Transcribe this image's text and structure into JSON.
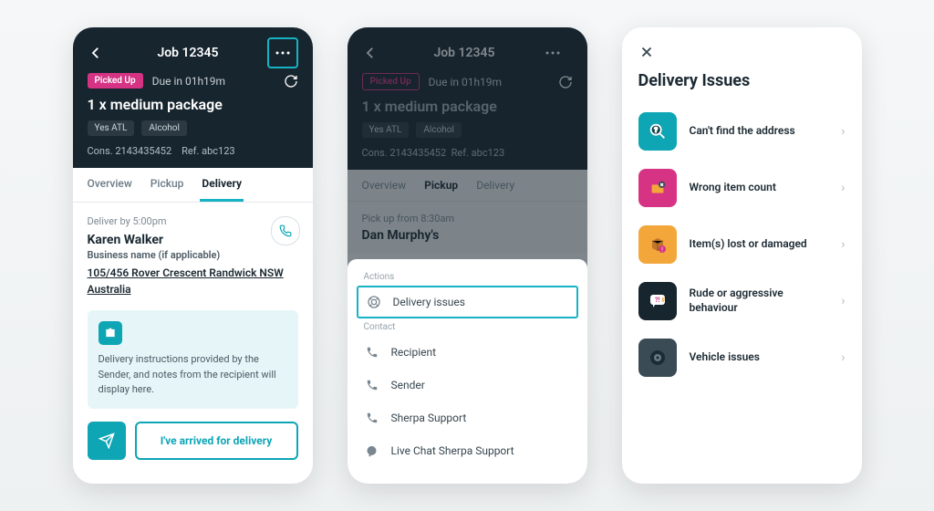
{
  "phone1": {
    "header": {
      "title": "Job 12345",
      "more_icon": "more-menu",
      "back_icon": "back"
    },
    "status": {
      "badge": "Picked Up",
      "due": "Due in 01h19m"
    },
    "package_line": "1 x medium package",
    "tags": [
      "Yes ATL",
      "Alcohol"
    ],
    "refs": {
      "cons": "Cons. 2143435452",
      "ref": "Ref. abc123"
    },
    "tabs": [
      "Overview",
      "Pickup",
      "Delivery"
    ],
    "active_tab": "Delivery",
    "deliver_by": "Deliver by 5:00pm",
    "recipient_name": "Karen Walker",
    "business": "Business name (if applicable)",
    "address": "105/456 Rover Crescent Randwick NSW Australia",
    "note": "Delivery instructions provided by the Sender, and notes from the recipient will display here.",
    "arrive_label": "I've arrived for delivery"
  },
  "phone2": {
    "header": {
      "title": "Job 12345"
    },
    "status": {
      "badge": "Picked Up",
      "due": "Due in 01h19m"
    },
    "package_line": "1 x medium package",
    "tags": [
      "Yes ATL",
      "Alcohol"
    ],
    "refs": {
      "cons": "Cons. 2143435452",
      "ref": "Ref. abc123"
    },
    "tabs": [
      "Overview",
      "Pickup",
      "Delivery"
    ],
    "active_tab": "Pickup",
    "pickup_from": "Pick up from 8:30am",
    "pickup_name": "Dan Murphy's",
    "sheet": {
      "actions_label": "Actions",
      "actions": [
        {
          "label": "Delivery issues",
          "icon": "lifebuoy"
        }
      ],
      "contact_label": "Contact",
      "contacts": [
        {
          "label": "Recipient",
          "icon": "phone"
        },
        {
          "label": "Sender",
          "icon": "phone"
        },
        {
          "label": "Sherpa Support",
          "icon": "phone"
        },
        {
          "label": "Live Chat Sherpa Support",
          "icon": "chat"
        }
      ]
    }
  },
  "phone3": {
    "title": "Delivery Issues",
    "issues": [
      {
        "label": "Can't find the address",
        "icon": "search-pin",
        "bg": "#0ea5b5"
      },
      {
        "label": "Wrong item count",
        "icon": "box-x",
        "bg": "#d63384"
      },
      {
        "label": "Item(s) lost or damaged",
        "icon": "package-alert",
        "bg": "#f3a73b"
      },
      {
        "label": "Rude or aggressive behaviour",
        "icon": "speech-warn",
        "bg": "#17252e"
      },
      {
        "label": "Vehicle issues",
        "icon": "tire",
        "bg": "#3a4b56"
      }
    ]
  }
}
